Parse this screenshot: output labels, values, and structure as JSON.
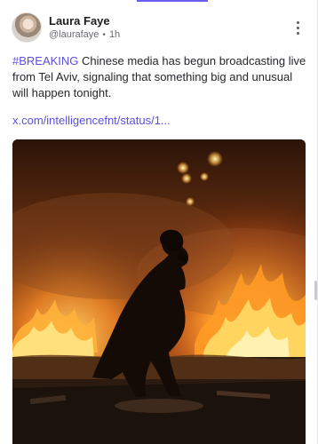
{
  "post": {
    "author": {
      "name": "Laura Faye",
      "handle": "@laurafaye",
      "time": "1h",
      "avatar_icon": "profile-photo"
    },
    "hashtag": "#BREAKING",
    "body": " Chinese media has begun broadcasting live from Tel Aviv, signaling that something big and unusual will happen tonight.",
    "link_text": "x.com/intelligencefnt/status/1...",
    "more_icon": "vertical-ellipsis-icon",
    "media": {
      "description_icon": "photo-fire-silhouette"
    }
  },
  "colors": {
    "accent": "#5b4fe0",
    "text": "#26262c",
    "meta": "#6b6b76"
  }
}
